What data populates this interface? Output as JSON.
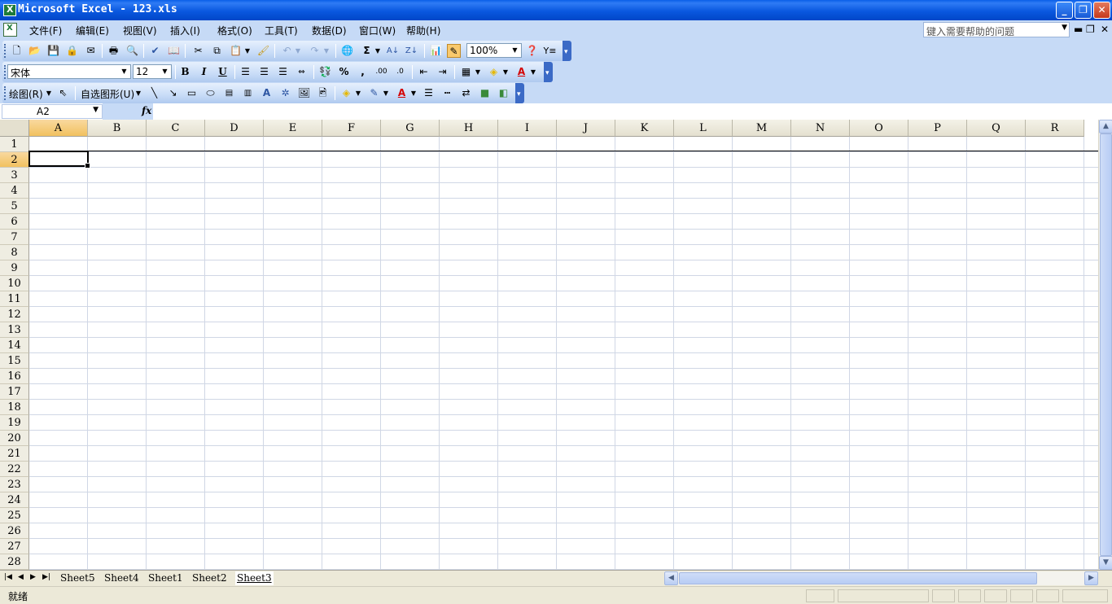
{
  "window": {
    "title": "Microsoft Excel - 123.xls",
    "minimize": "_",
    "restore": "❐",
    "close": "✕"
  },
  "menu": {
    "items": [
      "文件(F)",
      "编辑(E)",
      "视图(V)",
      "插入(I)",
      "格式(O)",
      "工具(T)",
      "数据(D)",
      "窗口(W)",
      "帮助(H)"
    ],
    "help_placeholder": "键入需要帮助的问题",
    "doc_min": "▬",
    "doc_restore": "❐",
    "doc_close": "✕"
  },
  "toolbar_standard": {
    "zoom": "100%"
  },
  "toolbar_format": {
    "font": "宋体",
    "size": "12",
    "bold": "B",
    "italic": "I",
    "underline": "U"
  },
  "toolbar_drawing": {
    "draw_label": "绘图(R)",
    "autoshapes_label": "自选图形(U)"
  },
  "formula_bar": {
    "name_box": "A2",
    "fx": "fx",
    "content": ""
  },
  "sheet": {
    "columns": [
      "A",
      "B",
      "C",
      "D",
      "E",
      "F",
      "G",
      "H",
      "I",
      "J",
      "K",
      "L",
      "M",
      "N",
      "O",
      "P",
      "Q",
      "R"
    ],
    "rows": [
      "1",
      "2",
      "3",
      "4",
      "5",
      "6",
      "7",
      "8",
      "9",
      "10",
      "11",
      "12",
      "13",
      "14",
      "15",
      "16",
      "17",
      "18",
      "19",
      "20",
      "21",
      "22",
      "23",
      "24",
      "25",
      "26",
      "27",
      "28"
    ],
    "active_cell": "A2",
    "active_col": "A",
    "active_row": "2"
  },
  "tabs": {
    "names": [
      "Sheet5",
      "Sheet4",
      "Sheet1",
      "Sheet2",
      "Sheet3"
    ],
    "active": "Sheet3"
  },
  "status": {
    "text": "就绪"
  }
}
